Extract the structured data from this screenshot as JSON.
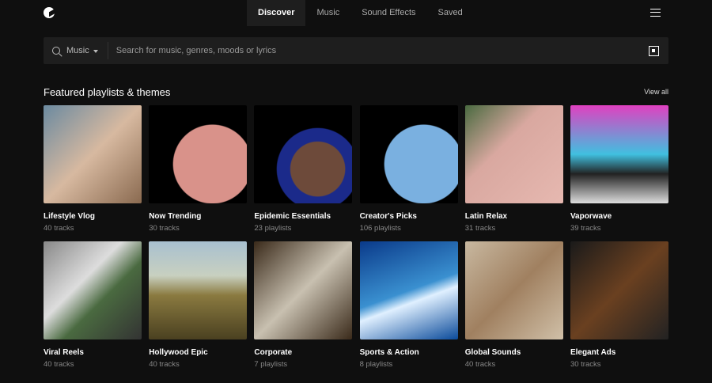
{
  "nav": {
    "tabs": [
      "Discover",
      "Music",
      "Sound Effects",
      "Saved"
    ]
  },
  "search": {
    "category": "Music",
    "placeholder": "Search for music, genres, moods or lyrics"
  },
  "section": {
    "title": "Featured playlists & themes",
    "view_all": "View all"
  },
  "cards": [
    {
      "title": "Lifestyle Vlog",
      "sub": "40 tracks",
      "bg": "linear-gradient(135deg,#6b8aa0,#d7b9a0 50%,#8a6a50)"
    },
    {
      "title": "Now Trending",
      "sub": "30 tracks",
      "bg": "radial-gradient(circle at 65% 60%,#d9928a 0 45%,#000 46%)"
    },
    {
      "title": "Epidemic Essentials",
      "sub": "23 playlists",
      "bg": "radial-gradient(circle at 65% 65%,#6d4a3a 0 30%,#1b2a8a 31% 45%,#000 46%)"
    },
    {
      "title": "Creator's Picks",
      "sub": "106 playlists",
      "bg": "radial-gradient(circle at 65% 60%,#7ab0e0 0 45%,#000 46%)"
    },
    {
      "title": "Latin Relax",
      "sub": "31 tracks",
      "bg": "linear-gradient(135deg,#4a6a40,#d9a8a0 40%,#e6b8b0)"
    },
    {
      "title": "Vaporwave",
      "sub": "39 tracks",
      "bg": "linear-gradient(180deg,#e040c0,#40c0e0 50%,#222 70%,#ddd)"
    },
    {
      "title": "Viral Reels",
      "sub": "40 tracks",
      "bg": "linear-gradient(135deg,#888,#ddd 40%,#4a6a40 60%,#333)"
    },
    {
      "title": "Hollywood Epic",
      "sub": "40 tracks",
      "bg": "linear-gradient(180deg,#a8c0d0,#c8d0c0 35%,#8a7a40 55%,#4a4020)"
    },
    {
      "title": "Corporate",
      "sub": "7 playlists",
      "bg": "linear-gradient(135deg,#3a2a1a,#c8c0b0 50%,#3a2a1a)"
    },
    {
      "title": "Sports & Action",
      "sub": "8 playlists",
      "bg": "linear-gradient(160deg,#0a3a8a,#3a90d0 50%,#e0f0ff 60%,#0a4a9a)"
    },
    {
      "title": "Global Sounds",
      "sub": "40 tracks",
      "bg": "linear-gradient(135deg,#c8b8a0,#a08060 50%,#d0c0a8)"
    },
    {
      "title": "Elegant Ads",
      "sub": "30 tracks",
      "bg": "linear-gradient(135deg,#1a1a1a,#6a4020 50%,#222)"
    }
  ]
}
